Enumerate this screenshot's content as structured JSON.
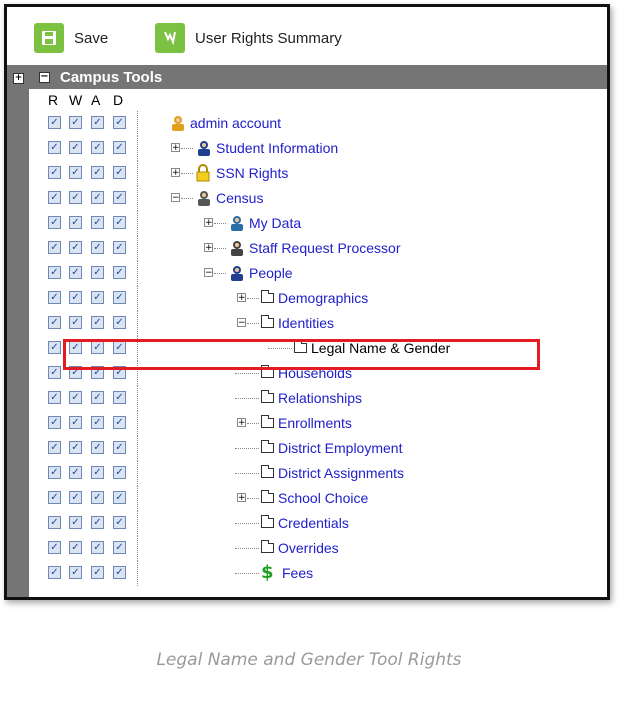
{
  "toolbar": {
    "save_label": "Save",
    "summary_label": "User Rights Summary"
  },
  "panel": {
    "title": "Campus Tools"
  },
  "columns": [
    "R",
    "W",
    "A",
    "D"
  ],
  "caption": "Legal Name and Gender Tool Rights",
  "tree": [
    {
      "label": "admin account",
      "depth": 0,
      "icon": "admin-icon",
      "expander": "none"
    },
    {
      "label": "Student Information",
      "depth": 1,
      "icon": "student-icon",
      "expander": "plus"
    },
    {
      "label": "SSN Rights",
      "depth": 1,
      "icon": "lock-icon",
      "expander": "plus"
    },
    {
      "label": "Census",
      "depth": 1,
      "icon": "census-icon",
      "expander": "minus"
    },
    {
      "label": "My Data",
      "depth": 2,
      "icon": "mydata-icon",
      "expander": "plus"
    },
    {
      "label": "Staff Request Processor",
      "depth": 2,
      "icon": "staff-request-icon",
      "expander": "plus"
    },
    {
      "label": "People",
      "depth": 2,
      "icon": "people-icon",
      "expander": "minus"
    },
    {
      "label": "Demographics",
      "depth": 3,
      "icon": "folder-icon",
      "expander": "plus"
    },
    {
      "label": "Identities",
      "depth": 3,
      "icon": "folder-icon",
      "expander": "minus"
    },
    {
      "label": "Legal Name & Gender",
      "depth": 4,
      "icon": "folder-icon",
      "expander": "none",
      "selected": true
    },
    {
      "label": "Households",
      "depth": 3,
      "icon": "folder-icon",
      "expander": "none"
    },
    {
      "label": "Relationships",
      "depth": 3,
      "icon": "folder-icon",
      "expander": "none"
    },
    {
      "label": "Enrollments",
      "depth": 3,
      "icon": "folder-icon",
      "expander": "plus"
    },
    {
      "label": "District Employment",
      "depth": 3,
      "icon": "folder-icon",
      "expander": "none"
    },
    {
      "label": "District Assignments",
      "depth": 3,
      "icon": "folder-icon",
      "expander": "none"
    },
    {
      "label": "School Choice",
      "depth": 3,
      "icon": "folder-icon",
      "expander": "plus"
    },
    {
      "label": "Credentials",
      "depth": 3,
      "icon": "folder-icon",
      "expander": "none"
    },
    {
      "label": "Overrides",
      "depth": 3,
      "icon": "folder-icon",
      "expander": "none"
    },
    {
      "label": "Fees",
      "depth": 3,
      "icon": "dollar-icon",
      "expander": "none"
    }
  ],
  "checked": true
}
